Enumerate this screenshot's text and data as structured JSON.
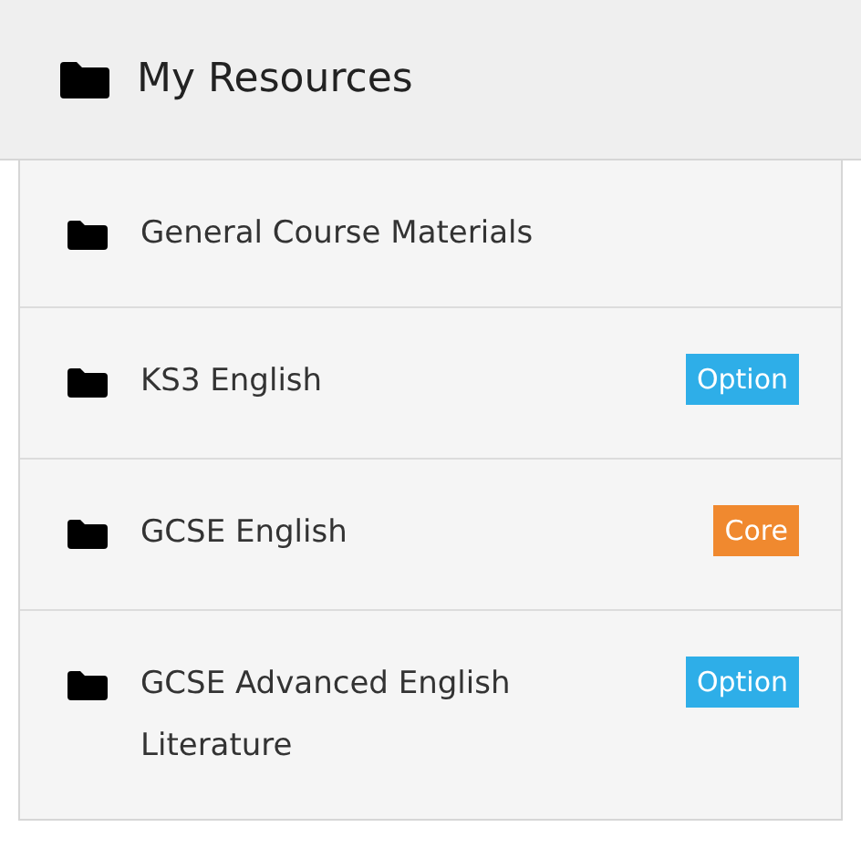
{
  "header": {
    "title": "My Resources"
  },
  "items": [
    {
      "label": "General Course Materials"
    },
    {
      "label": "KS3 English",
      "badge": {
        "text": "Option",
        "color": "#2eaee8"
      }
    },
    {
      "label": "GCSE English",
      "badge": {
        "text": "Core",
        "color": "#f0892f"
      }
    },
    {
      "label": "GCSE Advanced English Literature",
      "badge": {
        "text": "Option",
        "color": "#2eaee8"
      }
    }
  ]
}
